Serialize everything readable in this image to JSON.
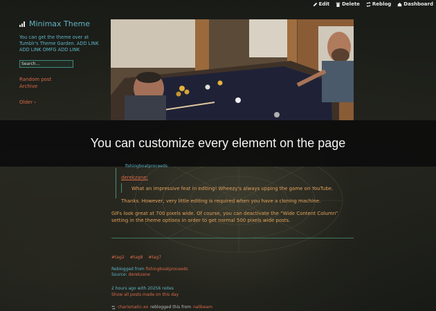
{
  "controls": {
    "edit": "Edit",
    "delete": "Delete",
    "reblog": "Reblog",
    "dashboard": "Dashboard"
  },
  "sidebar": {
    "title": "Minimax Theme",
    "description": "You can get the theme over at Tumblr's Theme Garden. ADD LINK ADD LINK OMFG ADD LINK",
    "search_value": "Search...",
    "nav": [
      "Random post",
      "Archive"
    ],
    "older": "Older ›"
  },
  "banner": {
    "text": "You can customize every element on the page"
  },
  "post": {
    "link_top": "fishingboatproceeds:",
    "author": "derekzane",
    "author_colon": ":",
    "quote1": "What an impressive feat in editing! Wheezy's always upping the game on YouTube.",
    "quote2": "Thanks. However, very little editing is required when you have a cloning machine.",
    "body": "GIFs look great at 700 pixels wide. Of course, you can deactivate the “Wide Content Column” setting in the theme options in order to get normal 500 pixels wide posts.",
    "tags": [
      "#tag2",
      "#tag8",
      "#tag7"
    ],
    "reblogged_label": "Reblogged from",
    "reblogged_from": "fishingboatproceeds",
    "source_label": "Source:",
    "source": "derekzane",
    "time": "2 hours ago with 20256 notes",
    "show_all": "Show all posts made on this day",
    "note_user": "charismatic-xo",
    "note_text": "reblogged this from",
    "note_from": "nalibeam"
  },
  "colors": {
    "accent_teal": "#5fb4c6",
    "link_orange": "#d96a4a",
    "text_amber": "#e3a15a",
    "banner_bg": "#0c0c0c"
  }
}
